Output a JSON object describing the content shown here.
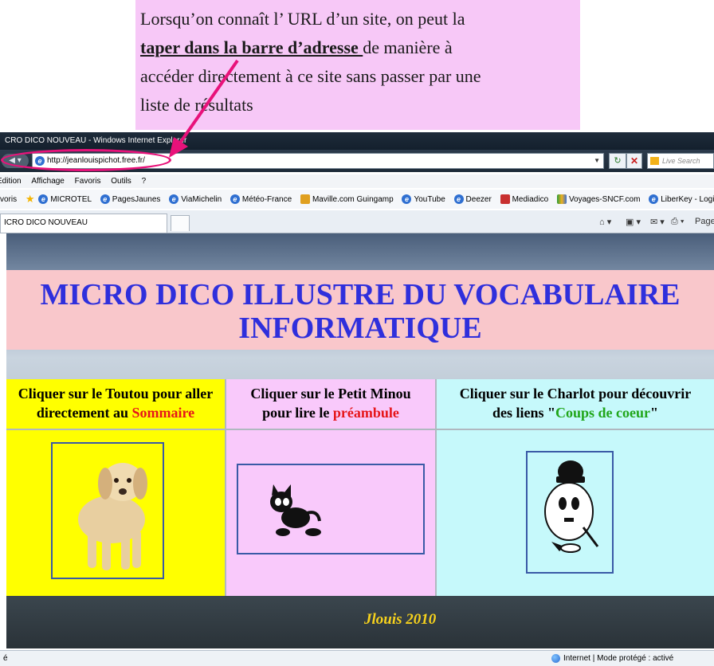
{
  "annotation": {
    "line1": " Lorsqu’on connaît l’ URL d’un site, on peut la",
    "emphasis": "taper dans la barre d’adresse ",
    "after_emphasis": "de manière à",
    "line3": "accéder directement à ce site sans passer par une",
    "line4": "liste de résultats",
    "highlight_color": "#e8127a"
  },
  "browser": {
    "window_title": "CRO DICO NOUVEAU - Windows Internet Explorer",
    "url": "http://jeanlouispichot.free.fr/",
    "search_placeholder": "Live Search",
    "menu": [
      "Edition",
      "Affichage",
      "Favoris",
      "Outils",
      "?"
    ],
    "favorites_label": "voris",
    "favorites": [
      {
        "label": "MICROTEL",
        "icon": "ie-icon"
      },
      {
        "label": "PagesJaunes",
        "icon": "ie-icon"
      },
      {
        "label": "ViaMichelin",
        "icon": "ie-icon"
      },
      {
        "label": "Météo-France",
        "icon": "ie-icon"
      },
      {
        "label": "Maville.com Guingamp",
        "icon": "maville-icon"
      },
      {
        "label": "YouTube",
        "icon": "ie-icon"
      },
      {
        "label": "Deezer",
        "icon": "ie-icon"
      },
      {
        "label": "Mediadico",
        "icon": "mediadico-icon"
      },
      {
        "label": "Voyages-SNCF.com",
        "icon": "sncf-icon"
      },
      {
        "label": "LiberKey - Logiciels",
        "icon": "ie-icon"
      }
    ],
    "tab_title": "ICRO DICO NOUVEAU",
    "command_page": "Page",
    "status_left": "é",
    "status_zone": "Internet | Mode protégé : activé"
  },
  "page": {
    "banner_line1": "MICRO DICO ILLUSTRE DU VOCABULAIRE",
    "banner_line2": "INFORMATIQUE",
    "cells": [
      {
        "text_a": "Cliquer sur le Toutou pour aller",
        "text_b": "directement au ",
        "link": "Sommaire",
        "bg": "#ffff00"
      },
      {
        "text_a": "Cliquer sur le Petit Minou",
        "text_b": "pour  lire le ",
        "link": "préambule",
        "bg": "#f9c9fb"
      },
      {
        "text_a": "Cliquer sur le Charlot pour découvrir",
        "text_b": "des liens \"",
        "link": "Coups de coeur",
        "text_c": "\"",
        "bg": "#c6f9fb"
      }
    ],
    "footer": "Jlouis 2010"
  }
}
